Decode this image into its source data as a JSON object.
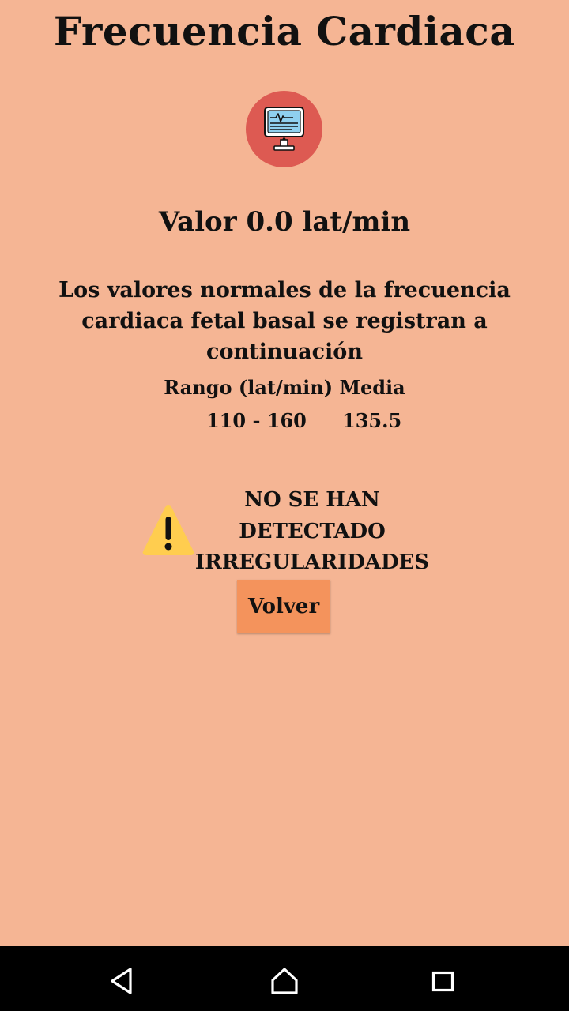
{
  "header": {
    "title": "Frecuencia Cardiaca",
    "icon": "monitor-heart-icon",
    "icon_badge_color": "#dd5a52"
  },
  "reading": {
    "label": "Valor",
    "value": "0.0",
    "unit": "lat/min"
  },
  "info": {
    "text": "Los valores normales de la frecuencia cardiaca fetal basal se registran a continuación",
    "range_header": "Rango (lat/min) Media",
    "range_value": "110 - 160",
    "mean_value": "135.5"
  },
  "status": {
    "icon": "warning-icon",
    "icon_color": "#ffcd4f",
    "message": "NO SE HAN DETECTADO IRREGULARIDADES"
  },
  "actions": {
    "back_label": "Volver",
    "back_color": "#f4935c"
  },
  "navbar": {
    "back_icon": "nav-back-icon",
    "home_icon": "nav-home-icon",
    "recents_icon": "nav-recents-icon"
  },
  "theme": {
    "background": "#f5b594",
    "text": "#111111"
  }
}
